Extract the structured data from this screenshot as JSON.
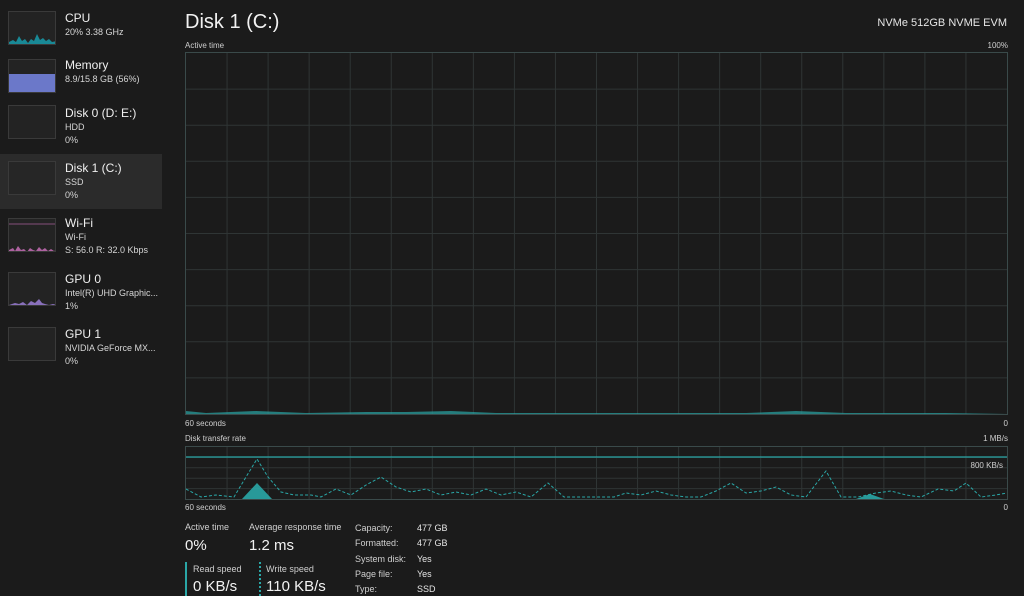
{
  "sidebar": {
    "items": [
      {
        "title": "CPU",
        "line1": "20% 3.38 GHz",
        "line2": "",
        "color": "#17b3c2"
      },
      {
        "title": "Memory",
        "line1": "8.9/15.8 GB (56%)",
        "line2": "",
        "color": "#7b87d6"
      },
      {
        "title": "Disk 0 (D: E:)",
        "line1": "HDD",
        "line2": "0%",
        "color": "#4caa4c"
      },
      {
        "title": "Disk 1 (C:)",
        "line1": "SSD",
        "line2": "0%",
        "color": "#4caa4c"
      },
      {
        "title": "Wi-Fi",
        "line1": "Wi-Fi",
        "line2": "S: 56.0 R: 32.0 Kbps",
        "color": "#d07ac0"
      },
      {
        "title": "GPU 0",
        "line1": "Intel(R) UHD Graphic...",
        "line2": "1%",
        "color": "#9b7ed6"
      },
      {
        "title": "GPU 1",
        "line1": "NVIDIA GeForce MX...",
        "line2": "0%",
        "color": "#9b7ed6"
      }
    ]
  },
  "header": {
    "title": "Disk 1 (C:)",
    "model": "NVMe 512GB NVME EVM"
  },
  "active_graph": {
    "label": "Active time",
    "max": "100%",
    "time": "60 seconds",
    "min": "0"
  },
  "transfer_graph": {
    "label": "Disk transfer rate",
    "max": "1 MB/s",
    "ref": "800 KB/s",
    "time": "60 seconds",
    "min": "0"
  },
  "stats": {
    "active_time_label": "Active time",
    "active_time": "0%",
    "response_label": "Average response time",
    "response": "1.2 ms",
    "read_label": "Read speed",
    "read": "0 KB/s",
    "write_label": "Write speed",
    "write": "110 KB/s"
  },
  "properties": [
    {
      "key": "Capacity:",
      "value": "477 GB"
    },
    {
      "key": "Formatted:",
      "value": "477 GB"
    },
    {
      "key": "System disk:",
      "value": "Yes"
    },
    {
      "key": "Page file:",
      "value": "Yes"
    },
    {
      "key": "Type:",
      "value": "SSD"
    }
  ],
  "colors": {
    "accent": "#2aa7a7",
    "grid": "#2f3535",
    "selected": "#2b2b2b"
  }
}
